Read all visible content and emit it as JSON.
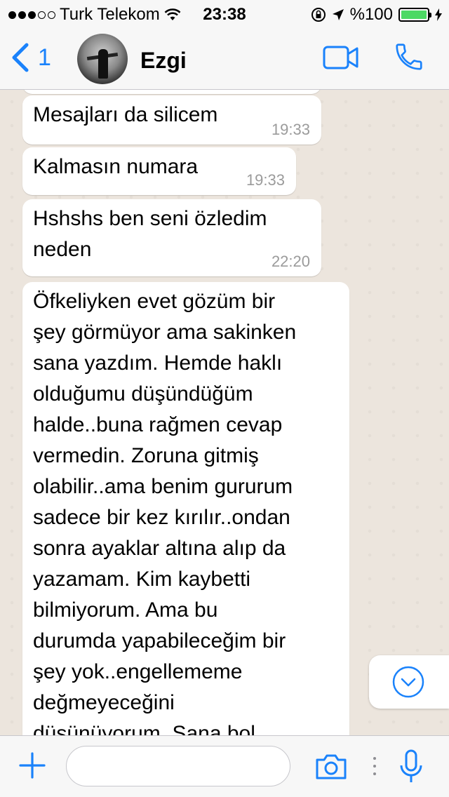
{
  "status_bar": {
    "carrier": "Turk Telekom",
    "time": "23:38",
    "battery_text": "%100",
    "signal_bars_filled": 3,
    "signal_bars_total": 5
  },
  "header": {
    "back_count": "1",
    "contact_name": "Ezgi"
  },
  "messages": [
    {
      "text": "Mesajları da silicem",
      "time": "19:33"
    },
    {
      "text": "Kalmasın numara",
      "time": "19:33"
    },
    {
      "text": "Hshshs ben seni özledim\nneden",
      "time": "22:20"
    },
    {
      "text": "Öfkeliyken evet gözüm bir\nşey görmüyor ama sakinken\nsana yazdım. Hemde haklı\nolduğumu düşündüğüm\nhalde..buna rağmen cevap\nvermedin. Zoruna gitmiş\nolabilir..ama benim gururum\nsadece bir kez kırılır..ondan\nsonra ayaklar altına alıp da\nyazamam. Kim kaybetti\nbilmiyorum. Ama bu\ndurumda yapabileceğim bir\nşey yok..engellememe\ndeğmeyeceğini\ndüşünüyorum. Sana bol",
      "time": ""
    }
  ],
  "composer": {
    "value": "",
    "placeholder": ""
  },
  "colors": {
    "accent": "#1a82fb",
    "chat_background": "#ece5dd",
    "bubble": "#ffffff",
    "battery": "#4cd964"
  }
}
